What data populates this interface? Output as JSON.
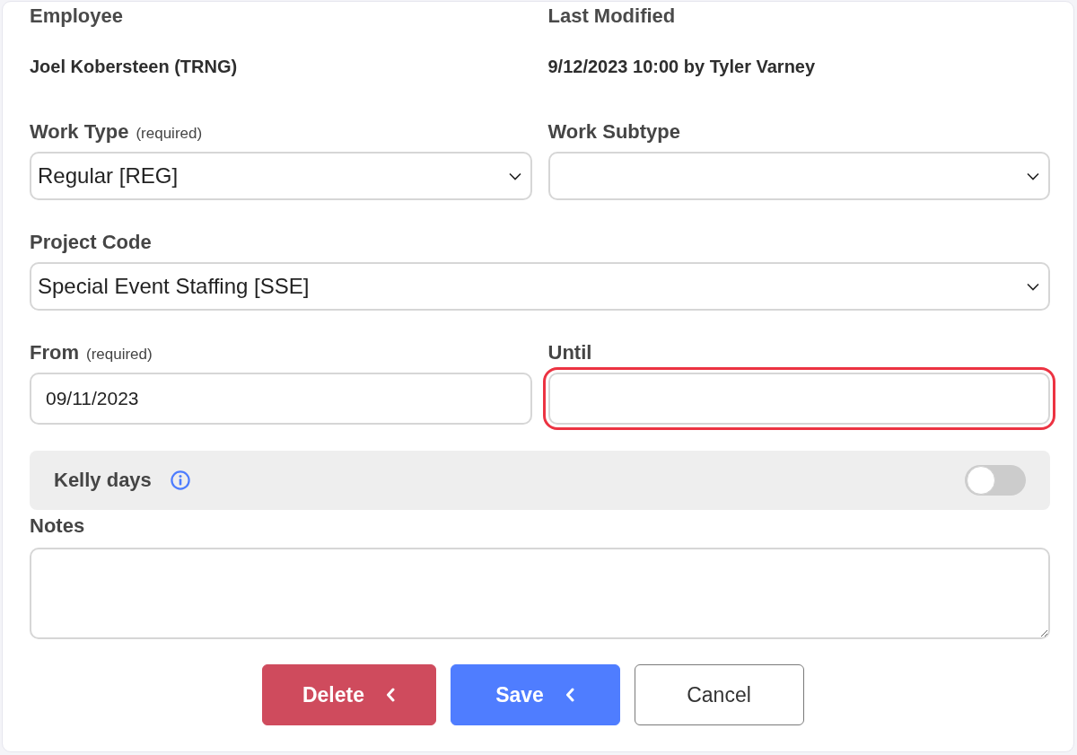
{
  "info": [
    {
      "label": "Employee",
      "value": "Joel Kobersteen (TRNG)"
    },
    {
      "label": "Last Modified",
      "value": "9/12/2023 10:00 by Tyler Varney"
    }
  ],
  "rows": [
    [
      {
        "kind": "select",
        "label": "Work Type",
        "hint": "(required)",
        "value": "Regular [REG]",
        "invalid": false
      },
      {
        "kind": "select",
        "label": "Work Subtype",
        "invalid": false
      }
    ],
    [
      {
        "kind": "select",
        "label": "Project Code",
        "value": "Special Event Staffing [SSE]",
        "invalid": false
      }
    ],
    [
      {
        "kind": "date",
        "label": "From",
        "hint": "(required)",
        "value": "09/11/2023",
        "invalid": false
      },
      {
        "kind": "date",
        "label": "Until",
        "invalid": true
      }
    ]
  ],
  "kelly_days": {
    "label": "Kelly days",
    "on": false
  },
  "notes": {
    "label": "Notes"
  },
  "buttons": [
    {
      "label": "Delete",
      "kind": "danger"
    },
    {
      "label": "Save",
      "kind": "primary"
    },
    {
      "label": "Cancel",
      "kind": "secondary"
    }
  ]
}
